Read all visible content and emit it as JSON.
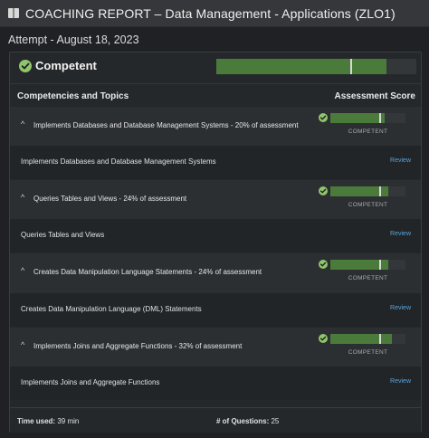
{
  "header": {
    "title": "COACHING REPORT – Data Management - Applications (ZLO1)"
  },
  "attempt": "Attempt - August 18, 2023",
  "summary": {
    "label": "Competent",
    "score_fraction": 0.85,
    "marker_fraction": 0.67
  },
  "columns": {
    "left": "Competencies and Topics",
    "right": "Assessment Score"
  },
  "review_label": "Review",
  "sections": [
    {
      "title": "Implements Databases and Database Management Systems - 20% of assessment",
      "status": "COMPETENT",
      "score_fraction": 0.72,
      "marker_fraction": 0.65,
      "topic": "Implements Databases and Database Management Systems"
    },
    {
      "title": "Queries Tables and Views - 24% of assessment",
      "status": "COMPETENT",
      "score_fraction": 0.77,
      "marker_fraction": 0.65,
      "topic": "Queries Tables and Views"
    },
    {
      "title": "Creates Data Manipulation Language Statements - 24% of assessment",
      "status": "COMPETENT",
      "score_fraction": 0.77,
      "marker_fraction": 0.65,
      "topic": "Creates Data Manipulation Language (DML) Statements"
    },
    {
      "title": "Implements Joins and Aggregate Functions - 32% of assessment",
      "status": "COMPETENT",
      "score_fraction": 0.82,
      "marker_fraction": 0.65,
      "topic": "Implements Joins and Aggregate Functions"
    }
  ],
  "footer": {
    "time_label": "Time used:",
    "time_value": "39 min",
    "questions_label": "# of Questions:",
    "questions_value": "25"
  },
  "colors": {
    "bar_fill": "#4b7b3a",
    "bar_track": "#34373a",
    "check": "#8fc56b",
    "link": "#5aa3d6"
  }
}
